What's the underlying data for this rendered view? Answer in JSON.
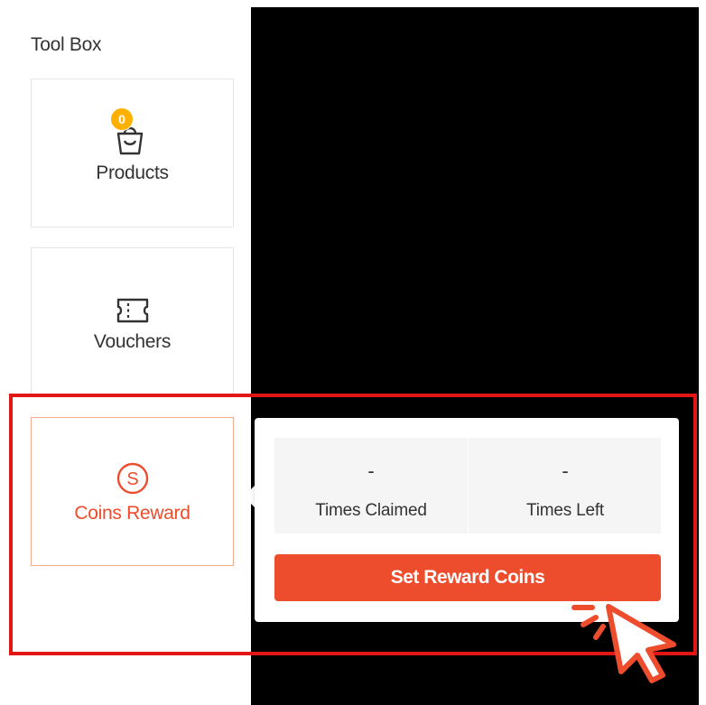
{
  "toolbox": {
    "title": "Tool Box",
    "products": {
      "label": "Products",
      "badge": "0",
      "icon": "shopping-bag-icon"
    },
    "vouchers": {
      "label": "Vouchers",
      "icon": "ticket-icon"
    },
    "coins": {
      "label": "Coins Reward",
      "icon": "coin-icon"
    }
  },
  "popover": {
    "times_claimed": {
      "value": "-",
      "label": "Times Claimed"
    },
    "times_left": {
      "value": "-",
      "label": "Times Left"
    },
    "button_label": "Set Reward Coins"
  },
  "colors": {
    "accent": "#ee4d2d",
    "badge": "#ffb000",
    "highlight": "#e31616"
  }
}
